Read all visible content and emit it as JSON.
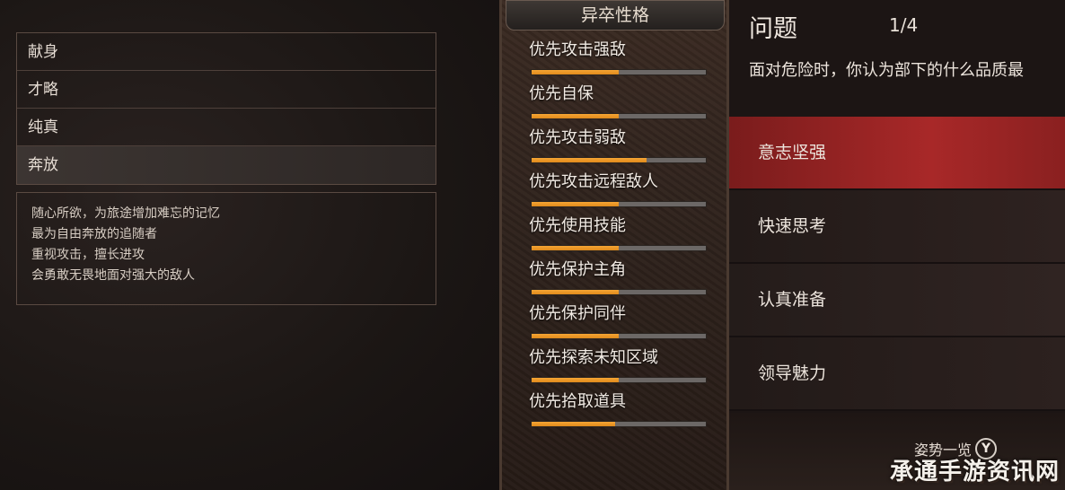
{
  "traits": {
    "items": [
      {
        "label": "献身",
        "selected": false
      },
      {
        "label": "才略",
        "selected": false
      },
      {
        "label": "纯真",
        "selected": false
      },
      {
        "label": "奔放",
        "selected": true
      }
    ],
    "description": [
      "随心所欲，为旅途增加难忘的记忆",
      "最为自由奔放的追随者",
      "重视攻击，擅长进攻",
      "会勇敢无畏地面对强大的敌人"
    ]
  },
  "personality": {
    "title": "异卒性格",
    "stats": [
      {
        "label": "优先攻击强敌",
        "value": 0.5
      },
      {
        "label": "优先自保",
        "value": 0.5
      },
      {
        "label": "优先攻击弱敌",
        "value": 0.66
      },
      {
        "label": "优先攻击远程敌人",
        "value": 0.5
      },
      {
        "label": "优先使用技能",
        "value": 0.5
      },
      {
        "label": "优先保护主角",
        "value": 0.5
      },
      {
        "label": "优先保护同伴",
        "value": 0.5
      },
      {
        "label": "优先探索未知区域",
        "value": 0.5
      },
      {
        "label": "优先拾取道具",
        "value": 0.48
      }
    ]
  },
  "question": {
    "title": "问题",
    "index": "1/4",
    "text": "面对危险时，你认为部下的什么品质最",
    "answers": [
      {
        "label": "意志坚强",
        "selected": true
      },
      {
        "label": "快速思考",
        "selected": false
      },
      {
        "label": "认真准备",
        "selected": false
      },
      {
        "label": "领导魅力",
        "selected": false
      }
    ]
  },
  "footer": {
    "posture_label": "姿势一览",
    "button_glyph": "Y"
  },
  "watermark": "承通手游资讯网",
  "colors": {
    "accent_orange": "#f5a534",
    "selected_red": "#a82828"
  }
}
